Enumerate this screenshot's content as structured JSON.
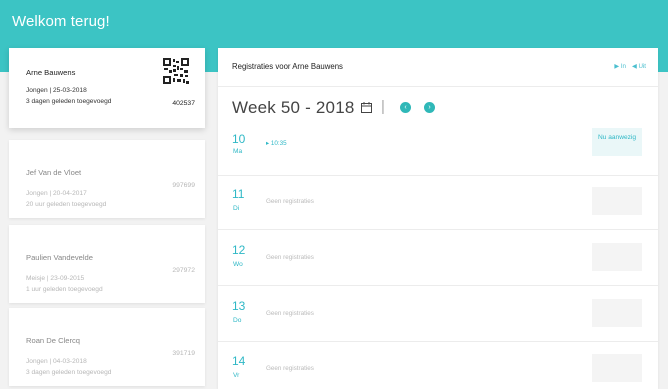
{
  "header": {
    "title": "Welkom terug!"
  },
  "active_child": {
    "name": "Arne Bauwens",
    "info": "Jongen | 25-03-2018",
    "added": "3 dagen geleden toegevoegd",
    "code": "402537"
  },
  "children": [
    {
      "name": "Jef Van de Vloet",
      "info": "Jongen | 20-04-2017",
      "added": "20 uur geleden toegevoegd",
      "code": "997699"
    },
    {
      "name": "Paulien Vandevelde",
      "info": "Meisje | 23-09-2015",
      "added": "1 uur geleden toegevoegd",
      "code": "297972"
    },
    {
      "name": "Roan De Clercq",
      "info": "Jongen | 04-03-2018",
      "added": "3 dagen geleden toegevoegd",
      "code": "391719"
    }
  ],
  "panel": {
    "title": "Registraties voor Arne Bauwens",
    "toggle_in": "In",
    "toggle_out": "Uit",
    "week_title": "Week 50 - 2018",
    "separator": "|",
    "prev_icon": "chevron-left-icon",
    "next_icon": "chevron-right-icon"
  },
  "days": [
    {
      "num": "10",
      "name": "Ma",
      "info": "10:35",
      "status": "Nu aanwezig"
    },
    {
      "num": "11",
      "name": "Di",
      "info": "Geen registraties"
    },
    {
      "num": "12",
      "name": "Wo",
      "info": "Geen registraties"
    },
    {
      "num": "13",
      "name": "Do",
      "info": "Geen registraties"
    },
    {
      "num": "14",
      "name": "Vr",
      "info": "Geen registraties"
    }
  ],
  "colors": {
    "accent": "#3cc4c4",
    "text_accent": "#2fb8c6"
  }
}
